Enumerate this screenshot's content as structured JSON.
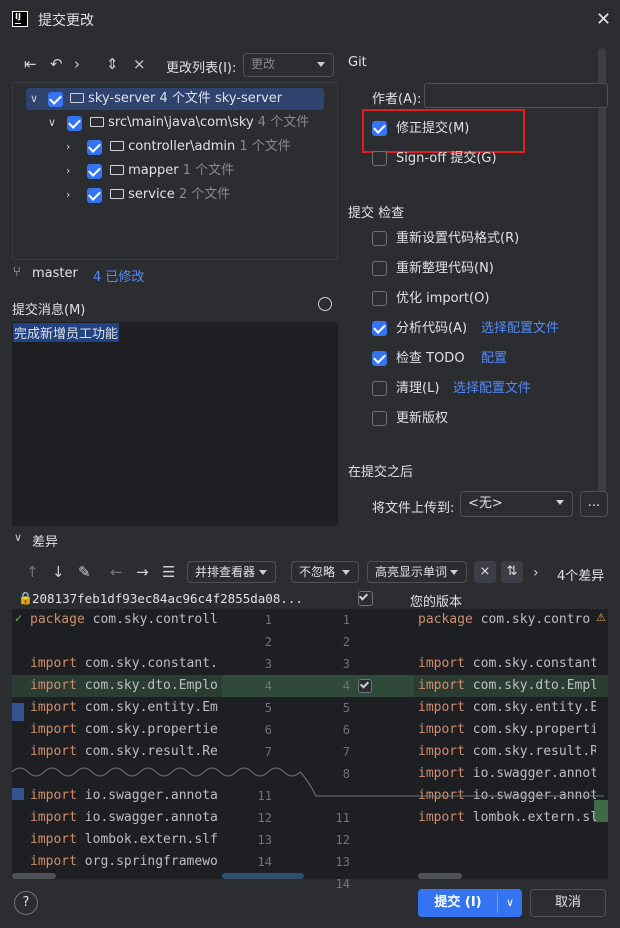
{
  "window": {
    "title": "提交更改",
    "logo_text": "IJ"
  },
  "toolbar": {
    "changelist_label": "更改列表(I):",
    "changelist_value": "更改"
  },
  "tree": {
    "root": {
      "name": "sky-server",
      "count": "4 个文件",
      "module": "sky-server"
    },
    "path": {
      "name": "src\\main\\java\\com\\sky",
      "count": "4 个文件"
    },
    "children": [
      {
        "name": "controller\\admin",
        "count": "1 个文件"
      },
      {
        "name": "mapper",
        "count": "1 个文件"
      },
      {
        "name": "service",
        "count": "2 个文件"
      }
    ]
  },
  "branch": {
    "name": "master",
    "modified": "4 已修改"
  },
  "commit_message": {
    "label": "提交消息(M)",
    "text": "完成新增员工功能"
  },
  "git": {
    "section": "Git",
    "author_label": "作者(A):",
    "author_value": "",
    "amend": "修正提交(M)",
    "signoff": "Sign-off 提交(G)"
  },
  "checks": {
    "section": "提交 检查",
    "items": [
      {
        "label": "重新设置代码格式(R)",
        "checked": false,
        "link": ""
      },
      {
        "label": "重新整理代码(N)",
        "checked": false,
        "link": ""
      },
      {
        "label": "优化 import(O)",
        "checked": false,
        "link": ""
      },
      {
        "label": "分析代码(A)",
        "checked": true,
        "link": "选择配置文件"
      },
      {
        "label": "检查 TODO",
        "checked": true,
        "link": "配置"
      },
      {
        "label": "清理(L)",
        "checked": false,
        "link": "选择配置文件"
      },
      {
        "label": "更新版权",
        "checked": false,
        "link": ""
      }
    ]
  },
  "after_commit": {
    "section": "在提交之后",
    "upload_label": "将文件上传到:",
    "upload_value": "<无>",
    "more": "..."
  },
  "diff": {
    "section": "差异",
    "viewer": "并排查看器",
    "ignore": "不忽略",
    "highlight": "高亮显示单词",
    "count": "4个差异",
    "left_title": "208137feb1df93ec84ac96c4f2855da08...",
    "right_title": "您的版本",
    "left_lines": [
      {
        "kw": "package",
        "rest": " com.sky.controll"
      },
      {
        "kw": "",
        "rest": ""
      },
      {
        "kw": "import",
        "rest": " com.sky.constant."
      },
      {
        "kw": "import",
        "rest": " com.sky.dto.Emplo"
      },
      {
        "kw": "import",
        "rest": " com.sky.entity.Em"
      },
      {
        "kw": "import",
        "rest": " com.sky.propertie"
      },
      {
        "kw": "import",
        "rest": " com.sky.result.Re"
      },
      {
        "kw": "",
        "rest": ""
      },
      {
        "kw": "import",
        "rest": " io.swagger.annota"
      },
      {
        "kw": "import",
        "rest": " io.swagger.annota"
      },
      {
        "kw": "import",
        "rest": " lombok.extern.slf"
      },
      {
        "kw": "import",
        "rest": " org.springframewo"
      }
    ],
    "left_nums": [
      "1",
      "2",
      "3",
      "4",
      "5",
      "6",
      "7",
      "",
      "11",
      "12",
      "13",
      "14"
    ],
    "right_nums": [
      "1",
      "2",
      "3",
      "4",
      "5",
      "6",
      "7",
      "8",
      "",
      "11",
      "12",
      "13",
      "14"
    ],
    "right_lines": [
      {
        "kw": "package",
        "rest": " com.sky.contro"
      },
      {
        "kw": "",
        "rest": ""
      },
      {
        "kw": "import",
        "rest": " com.sky.constant."
      },
      {
        "kw": "import",
        "rest": " com.sky.dto.Emplo"
      },
      {
        "kw": "import",
        "rest": " com.sky.entity.Em"
      },
      {
        "kw": "import",
        "rest": " com.sky.propertie"
      },
      {
        "kw": "import",
        "rest": " com.sky.result.Re"
      },
      {
        "kw": "",
        "rest": ""
      },
      {
        "kw": "import",
        "rest": " io.swagger.annota"
      },
      {
        "kw": "import",
        "rest": " io.swagger.annota"
      },
      {
        "kw": "import",
        "rest": " lombok.extern.slf"
      }
    ]
  },
  "footer": {
    "help": "?",
    "commit": "提交 (I)",
    "cancel": "取消"
  },
  "colors": {
    "accent": "#3574f0",
    "link": "#548af7",
    "highlight_box": "#e02020",
    "changed_line": "#2f4a3a"
  }
}
